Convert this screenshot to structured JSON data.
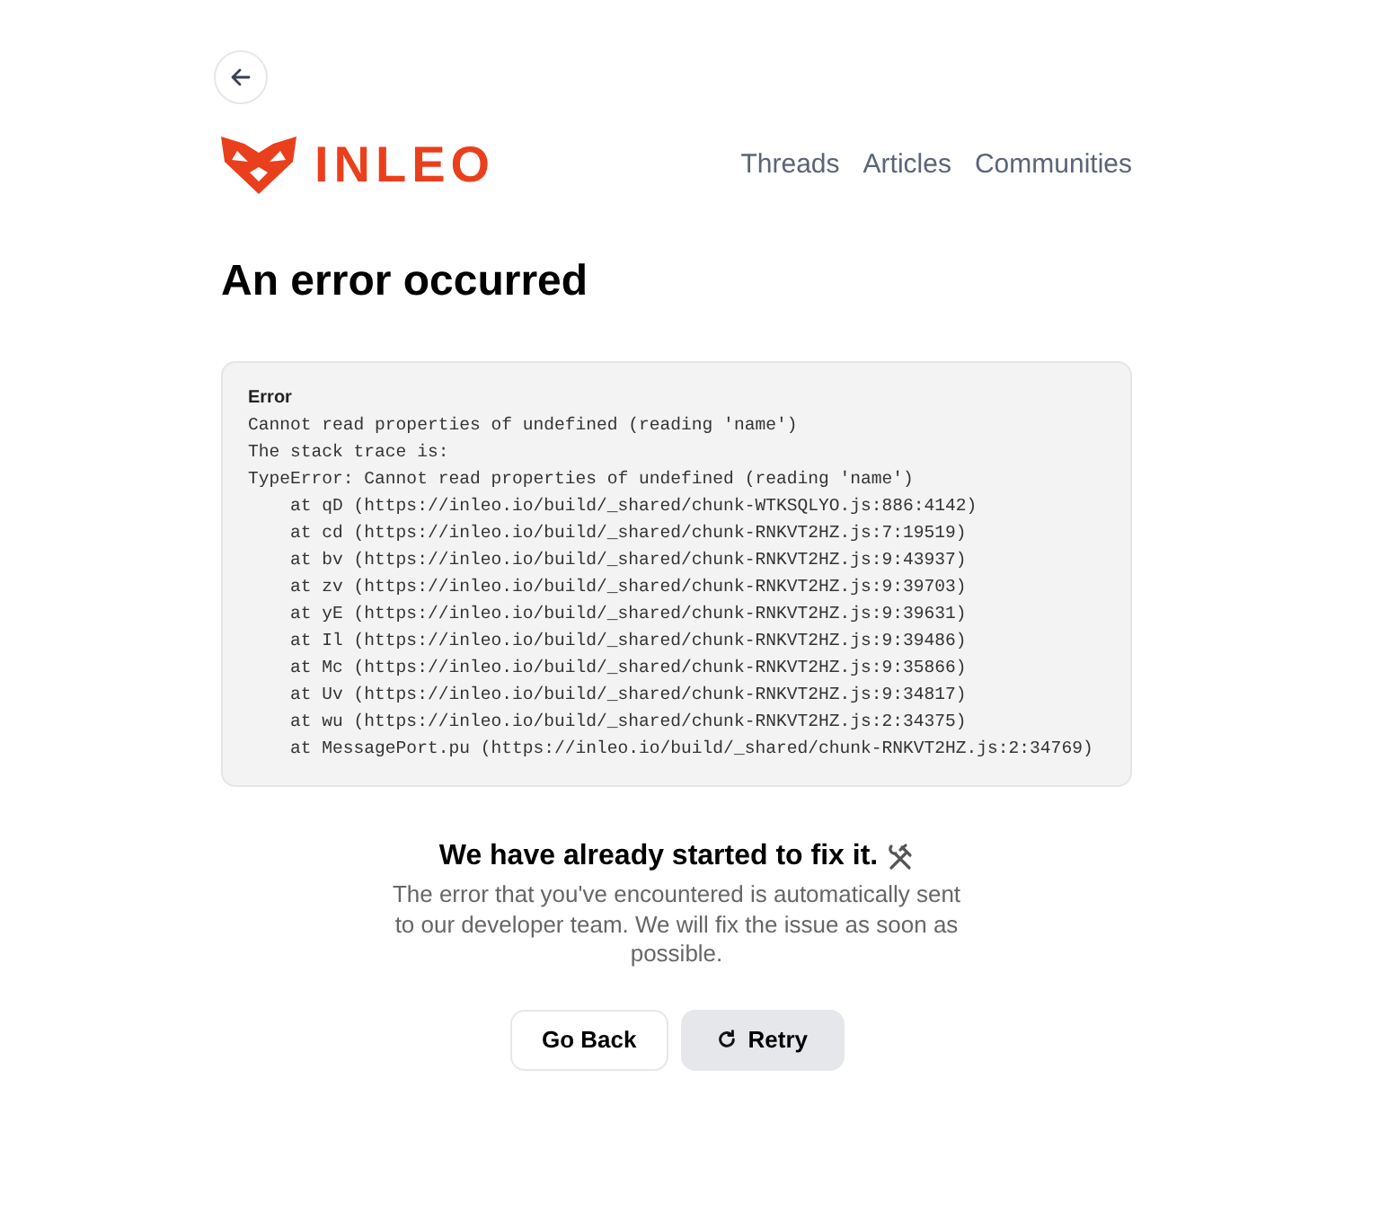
{
  "header": {
    "logo_text": "INLEO",
    "nav": [
      {
        "label": "Threads"
      },
      {
        "label": "Articles"
      },
      {
        "label": "Communities"
      }
    ]
  },
  "title": "An error occurred",
  "error_box": {
    "label": "Error",
    "lines": [
      "Cannot read properties of undefined (reading 'name')",
      "The stack trace is:",
      "TypeError: Cannot read properties of undefined (reading 'name')",
      "    at qD (https://inleo.io/build/_shared/chunk-WTKSQLYO.js:886:4142)",
      "    at cd (https://inleo.io/build/_shared/chunk-RNKVT2HZ.js:7:19519)",
      "    at bv (https://inleo.io/build/_shared/chunk-RNKVT2HZ.js:9:43937)",
      "    at zv (https://inleo.io/build/_shared/chunk-RNKVT2HZ.js:9:39703)",
      "    at yE (https://inleo.io/build/_shared/chunk-RNKVT2HZ.js:9:39631)",
      "    at Il (https://inleo.io/build/_shared/chunk-RNKVT2HZ.js:9:39486)",
      "    at Mc (https://inleo.io/build/_shared/chunk-RNKVT2HZ.js:9:35866)",
      "    at Uv (https://inleo.io/build/_shared/chunk-RNKVT2HZ.js:9:34817)",
      "    at wu (https://inleo.io/build/_shared/chunk-RNKVT2HZ.js:2:34375)",
      "    at MessagePort.pu (https://inleo.io/build/_shared/chunk-RNKVT2HZ.js:2:34769)"
    ]
  },
  "notice": {
    "heading": "We have already started to fix it.",
    "text": "The error that you've encountered is automatically sent to our developer team. We will fix the issue as soon as possible."
  },
  "buttons": [
    {
      "kind": "outline",
      "label": "Go Back"
    },
    {
      "kind": "retry",
      "label": "Retry"
    }
  ]
}
